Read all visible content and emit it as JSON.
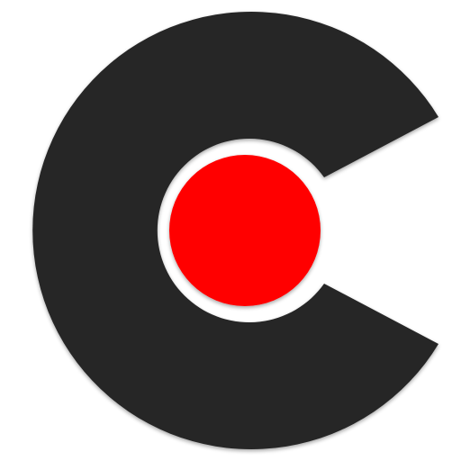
{
  "logo": {
    "icon": "record-logo-icon",
    "colors": {
      "background": "#ffffff",
      "ring": "#262626",
      "dot": "#ff0000",
      "gap": "#ffffff"
    }
  }
}
